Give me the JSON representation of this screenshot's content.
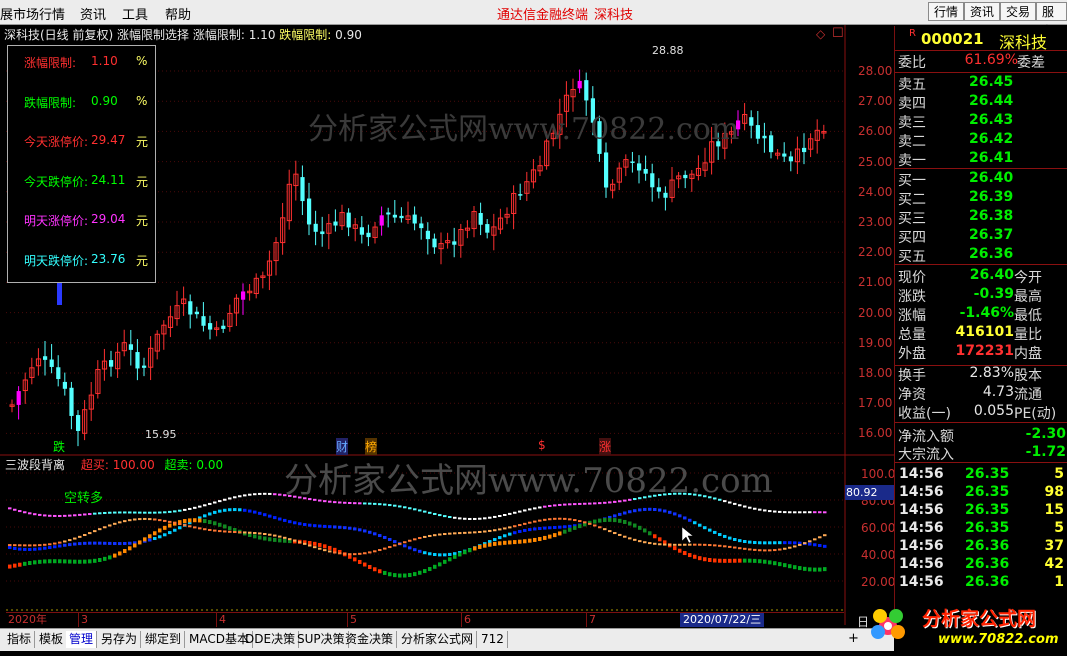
{
  "menu": {
    "items": [
      "展市场行情",
      "资讯",
      "工具",
      "帮助"
    ],
    "ad_text": "通达信金融终端",
    "ad_stock": "深科技",
    "right_tabs": [
      "行情",
      "资讯",
      "交易",
      "服务"
    ]
  },
  "chart_header": {
    "stock": "深科技(日线 前复权)",
    "indicator": "涨幅限制选择",
    "up_label": "涨幅限制:",
    "up_value": "1.10",
    "down_label": "跌幅限制:",
    "down_value": "0.90"
  },
  "limit_box": [
    {
      "label": "涨幅限制:",
      "value": "1.10",
      "unit": "%",
      "color": "#ff3030"
    },
    {
      "label": "跌幅限制:",
      "value": "0.90",
      "unit": "%",
      "color": "#00ff00"
    },
    {
      "label": "今天涨停价:",
      "value": "29.47",
      "unit": "元",
      "color": "#ff3030"
    },
    {
      "label": "今天跌停价:",
      "value": "24.11",
      "unit": "元",
      "color": "#00ff00"
    },
    {
      "label": "明天涨停价:",
      "value": "29.04",
      "unit": "元",
      "color": "#ff33ff"
    },
    {
      "label": "明天跌停价:",
      "value": "23.76",
      "unit": "元",
      "color": "#33ffff"
    }
  ],
  "watermark": "分析家公式网www.70822.com",
  "price_axis": [
    "28.00",
    "27.00",
    "26.00",
    "25.00",
    "24.00",
    "23.00",
    "22.00",
    "21.00",
    "20.00",
    "19.00",
    "18.00",
    "17.00",
    "16.00"
  ],
  "high_label": "28.88",
  "low_label": "15.95",
  "event_marks": [
    {
      "text": "跌",
      "color": "#00ff00"
    },
    {
      "text": "财",
      "color": "#66aaff"
    },
    {
      "text": "榜",
      "color": "#ffaa00"
    },
    {
      "text": "$",
      "color": "#ff3030"
    },
    {
      "text": "涨",
      "color": "#ff3030"
    }
  ],
  "indicator": {
    "name": "三波段背离",
    "buy_label": "超买:",
    "buy_value": "100.00",
    "sell_label": "超卖:",
    "sell_value": "0.00",
    "note": "空转多",
    "axis": [
      "100.0",
      "80.00",
      "60.00",
      "40.00",
      "20.00"
    ],
    "cursor_value": "80.92"
  },
  "date_axis": {
    "labels": [
      "2020年",
      "3",
      "4",
      "5",
      "6",
      "7"
    ],
    "cursor_date": "2020/07/22/三",
    "right_mark": "日"
  },
  "bottom_tabs": [
    "指标",
    "模板",
    "管理",
    "另存为",
    "绑定到",
    "MACD基本",
    "DDE决策",
    "SUP决策",
    "资金决策",
    "分析家公式网",
    "712"
  ],
  "active_tab": "管理",
  "quote": {
    "code": "000021",
    "name": "深科技",
    "r_mark": "R",
    "weibi_label": "委比",
    "weibi_value": "61.69%",
    "weicha_label": "委差",
    "asks": [
      {
        "label": "卖五",
        "price": "26.45"
      },
      {
        "label": "卖四",
        "price": "26.44"
      },
      {
        "label": "卖三",
        "price": "26.43"
      },
      {
        "label": "卖二",
        "price": "26.42"
      },
      {
        "label": "卖一",
        "price": "26.41"
      }
    ],
    "bids": [
      {
        "label": "买一",
        "price": "26.40"
      },
      {
        "label": "买二",
        "price": "26.39"
      },
      {
        "label": "买三",
        "price": "26.38"
      },
      {
        "label": "买四",
        "price": "26.37"
      },
      {
        "label": "买五",
        "price": "26.36"
      }
    ],
    "stats": [
      {
        "label": "现价",
        "value": "26.40",
        "right": "今开",
        "color": "#00ee00"
      },
      {
        "label": "涨跌",
        "value": "-0.39",
        "right": "最高",
        "color": "#00ee00"
      },
      {
        "label": "涨幅",
        "value": "-1.46%",
        "right": "最低",
        "color": "#00ee00"
      },
      {
        "label": "总量",
        "value": "416101",
        "right": "量比",
        "color": "#ffff33"
      },
      {
        "label": "外盘",
        "value": "172231",
        "right": "内盘",
        "color": "#ff3030"
      }
    ],
    "stats2": [
      {
        "label": "换手",
        "value": "2.83%",
        "right": "股本",
        "color": "#e8e8e8"
      },
      {
        "label": "净资",
        "value": "4.73",
        "right": "流通",
        "color": "#e8e8e8"
      },
      {
        "label": "收益(一)",
        "value": "0.055",
        "right": "PE(动)",
        "color": "#e8e8e8"
      }
    ],
    "flows": [
      {
        "label": "净流入额",
        "value": "-2.30"
      },
      {
        "label": "大宗流入",
        "value": "-1.72"
      }
    ],
    "ticks": [
      {
        "time": "14:56",
        "price": "26.35",
        "vol": "5"
      },
      {
        "time": "14:56",
        "price": "26.35",
        "vol": "98"
      },
      {
        "time": "14:56",
        "price": "26.35",
        "vol": "15"
      },
      {
        "time": "14:56",
        "price": "26.35",
        "vol": "5"
      },
      {
        "time": "14:56",
        "price": "26.36",
        "vol": "37"
      },
      {
        "time": "14:56",
        "price": "26.36",
        "vol": "42"
      },
      {
        "time": "14:56",
        "price": "26.36",
        "vol": "1"
      }
    ]
  },
  "logo": {
    "name": "分析家公式网",
    "url": "www.70822.com"
  },
  "colors": {
    "up": "#ff3030",
    "down": "#54ffff",
    "limit": "#ff00ff",
    "grid": "#7a1010"
  }
}
